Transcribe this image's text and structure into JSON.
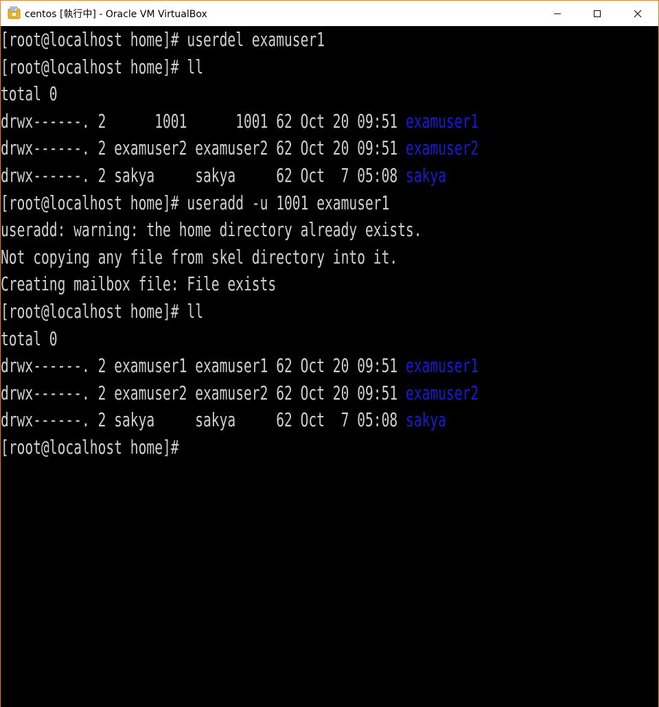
{
  "window": {
    "title": "centos [執行中] - Oracle VM VirtualBox",
    "icon": "virtualbox-icon",
    "accent_color": "#d9822b"
  },
  "controls": {
    "minimize": "minimize-icon",
    "maximize": "maximize-icon",
    "close": "close-icon"
  },
  "console": {
    "text_color": "#d0d0d0",
    "dir_color": "#1a1ad6",
    "lines": [
      {
        "text": "[root@localhost home]# userdel examuser1",
        "dir": ""
      },
      {
        "text": "[root@localhost home]# ll",
        "dir": ""
      },
      {
        "text": "total 0",
        "dir": ""
      },
      {
        "text": "drwx------. 2      1001      1001 62 Oct 20 09:51 ",
        "dir": "examuser1"
      },
      {
        "text": "drwx------. 2 examuser2 examuser2 62 Oct 20 09:51 ",
        "dir": "examuser2"
      },
      {
        "text": "drwx------. 2 sakya     sakya     62 Oct  7 05:08 ",
        "dir": "sakya"
      },
      {
        "text": "[root@localhost home]# useradd -u 1001 examuser1",
        "dir": ""
      },
      {
        "text": "useradd: warning: the home directory already exists.",
        "dir": ""
      },
      {
        "text": "Not copying any file from skel directory into it.",
        "dir": ""
      },
      {
        "text": "Creating mailbox file: File exists",
        "dir": ""
      },
      {
        "text": "[root@localhost home]# ll",
        "dir": ""
      },
      {
        "text": "total 0",
        "dir": ""
      },
      {
        "text": "drwx------. 2 examuser1 examuser1 62 Oct 20 09:51 ",
        "dir": "examuser1"
      },
      {
        "text": "drwx------. 2 examuser2 examuser2 62 Oct 20 09:51 ",
        "dir": "examuser2"
      },
      {
        "text": "drwx------. 2 sakya     sakya     62 Oct  7 05:08 ",
        "dir": "sakya"
      },
      {
        "text": "[root@localhost home]#",
        "dir": ""
      }
    ]
  }
}
